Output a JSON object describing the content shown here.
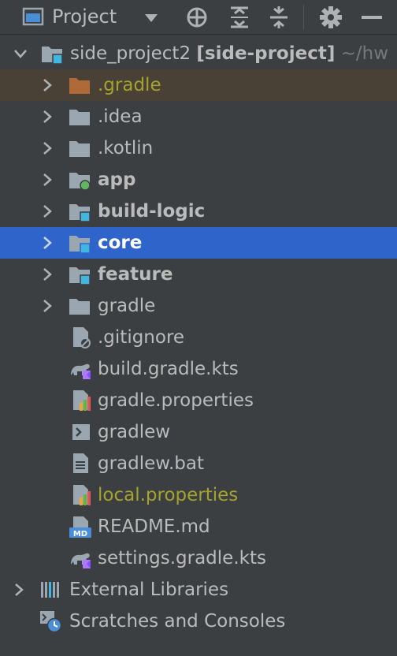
{
  "toolbar": {
    "title": "Project",
    "actions": [
      "locate-icon",
      "expand-all-icon",
      "collapse-all-icon",
      "gear-icon",
      "minimize-icon"
    ]
  },
  "root": {
    "name": "side_project2",
    "module": "[side-project]",
    "path": "~/hw"
  },
  "tree": [
    {
      "label": ".gradle",
      "icon": "folder-orange-icon",
      "expandable": true
    },
    {
      "label": ".idea",
      "icon": "folder-icon",
      "expandable": true
    },
    {
      "label": ".kotlin",
      "icon": "folder-icon",
      "expandable": true
    },
    {
      "label": "app",
      "icon": "app-module-folder-icon",
      "expandable": true
    },
    {
      "label": "build-logic",
      "icon": "module-folder-icon",
      "expandable": true
    },
    {
      "label": "core",
      "icon": "module-folder-icon",
      "expandable": true,
      "selected": true
    },
    {
      "label": "feature",
      "icon": "module-folder-icon",
      "expandable": true
    },
    {
      "label": "gradle",
      "icon": "folder-icon",
      "expandable": true
    },
    {
      "label": ".gitignore",
      "icon": "ignored-file-icon"
    },
    {
      "label": "build.gradle.kts",
      "icon": "gradle-kotlin-icon"
    },
    {
      "label": "gradle.properties",
      "icon": "properties-file-icon"
    },
    {
      "label": "gradlew",
      "icon": "shell-script-icon"
    },
    {
      "label": "gradlew.bat",
      "icon": "text-file-icon"
    },
    {
      "label": "local.properties",
      "icon": "properties-file-icon"
    },
    {
      "label": "README.md",
      "icon": "markdown-file-icon"
    },
    {
      "label": "settings.gradle.kts",
      "icon": "gradle-kotlin-icon"
    }
  ],
  "bottom": [
    {
      "label": "External Libraries",
      "icon": "libraries-icon"
    },
    {
      "label": "Scratches and Consoles",
      "icon": "scratches-icon"
    }
  ],
  "colors": {
    "panel": "#3c3f41",
    "selection": "#2f65ca",
    "highlight_row": "#4a4136",
    "excluded_text": "#a4a32c",
    "folder": "#9aa7b0",
    "folder_orange": "#b06a3a",
    "module_badge": "#40b6e0"
  }
}
